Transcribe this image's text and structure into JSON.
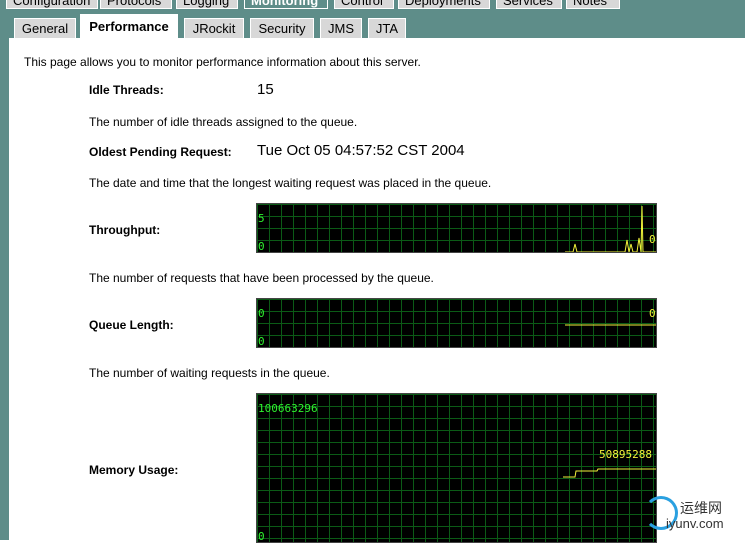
{
  "top_tabs": [
    {
      "label": "Configuration"
    },
    {
      "label": "Protocols"
    },
    {
      "label": "Logging"
    },
    {
      "label": "Monitoring",
      "active": true
    },
    {
      "label": "Control"
    },
    {
      "label": "Deployments"
    },
    {
      "label": "Services"
    },
    {
      "label": "Notes"
    }
  ],
  "tabs": [
    {
      "label": "General"
    },
    {
      "label": "Performance",
      "active": true
    },
    {
      "label": "JRockit"
    },
    {
      "label": "Security"
    },
    {
      "label": "JMS"
    },
    {
      "label": "JTA"
    }
  ],
  "intro": "This page allows you to monitor performance information about this server.",
  "idle_threads": {
    "label": "Idle Threads:",
    "value": "15",
    "description": "The number of idle threads assigned to the queue."
  },
  "oldest_pending": {
    "label": "Oldest Pending Request:",
    "value": "Tue Oct 05 04:57:52 CST 2004",
    "description": "The date and time that the longest waiting request was placed in the queue."
  },
  "throughput": {
    "label": "Throughput:",
    "max_label": "5",
    "min_label": "0",
    "current_label": "0",
    "description": "The number of requests that have been processed by the queue."
  },
  "queue_length": {
    "label": "Queue Length:",
    "max_label": "0",
    "min_label": "0",
    "current_label": "0",
    "description": "The number of waiting requests in the queue."
  },
  "memory_usage": {
    "label": "Memory Usage:",
    "max_label": "100663296",
    "min_label": "0",
    "current_label": "50895288"
  },
  "colors": {
    "frame": "#5e8d89",
    "graph_bg": "#000000",
    "grid": "#0b5a16",
    "axis_label": "#2ef22e",
    "trace": "#f2f23a"
  },
  "watermark": {
    "cn": "运维网",
    "en": "iyunv.com"
  }
}
